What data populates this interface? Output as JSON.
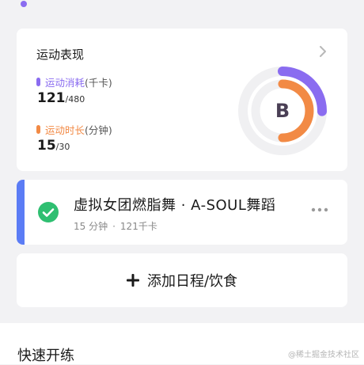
{
  "performance": {
    "title": "运动表现",
    "calories": {
      "label": "运动消耗",
      "unit": "(千卡)",
      "value": "121",
      "target": "/480",
      "color": "#8a6cf0",
      "progress": 0.252
    },
    "duration": {
      "label": "运动时长",
      "unit": "(分钟)",
      "value": "15",
      "target": "/30",
      "color": "#f28a45",
      "progress": 0.5
    },
    "grade": "B",
    "grade_color": "#4a3f55"
  },
  "activity": {
    "title": "虚拟女团燃脂舞 · A-SOUL舞蹈",
    "duration": "15 分钟",
    "separator": "·",
    "calories": "121千卡",
    "accent_color": "#5b7cf5",
    "check_color": "#2fbf71"
  },
  "add_entry": {
    "label": "添加日程/饮食"
  },
  "quick_start": {
    "title": "快速开练"
  },
  "watermark": "@稀土掘金技术社区"
}
